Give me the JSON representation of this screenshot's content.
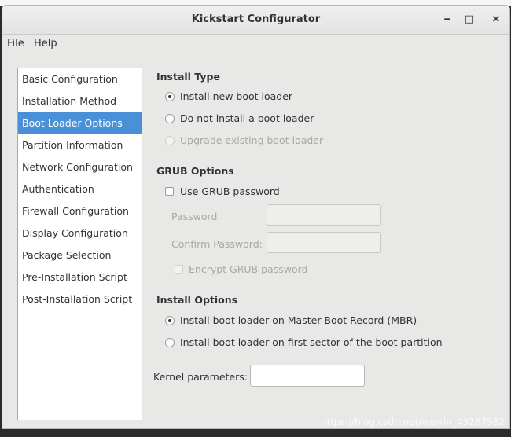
{
  "window": {
    "title": "Kickstart Configurator",
    "controls": {
      "minimize": "‒",
      "maximize": "□",
      "close": "×"
    }
  },
  "menubar": {
    "items": [
      "File",
      "Help"
    ]
  },
  "sidebar": {
    "items": [
      {
        "label": "Basic Configuration",
        "selected": false
      },
      {
        "label": "Installation Method",
        "selected": false
      },
      {
        "label": "Boot Loader Options",
        "selected": true
      },
      {
        "label": "Partition Information",
        "selected": false
      },
      {
        "label": "Network Configuration",
        "selected": false
      },
      {
        "label": "Authentication",
        "selected": false
      },
      {
        "label": "Firewall Configuration",
        "selected": false
      },
      {
        "label": "Display Configuration",
        "selected": false
      },
      {
        "label": "Package Selection",
        "selected": false
      },
      {
        "label": "Pre-Installation Script",
        "selected": false
      },
      {
        "label": "Post-Installation Script",
        "selected": false
      }
    ]
  },
  "install_type": {
    "heading": "Install Type",
    "options": [
      {
        "label": "Install new boot loader",
        "checked": true,
        "enabled": true
      },
      {
        "label": "Do not install a boot loader",
        "checked": false,
        "enabled": true
      },
      {
        "label": "Upgrade existing boot loader",
        "checked": false,
        "enabled": false
      }
    ]
  },
  "grub_options": {
    "heading": "GRUB Options",
    "use_password_label": "Use GRUB password",
    "use_password_checked": false,
    "password_label": "Password:",
    "password_value": "",
    "confirm_label": "Confirm Password:",
    "confirm_value": "",
    "encrypt_label": "Encrypt GRUB password",
    "encrypt_checked": false
  },
  "install_options": {
    "heading": "Install Options",
    "options": [
      {
        "label": "Install boot loader on Master Boot Record (MBR)",
        "checked": true
      },
      {
        "label": "Install boot loader on first sector of the boot partition",
        "checked": false
      }
    ]
  },
  "kernel": {
    "label": "Kernel parameters:",
    "value": ""
  },
  "watermark": "https://blog.csdn.net/weixin_43287982"
}
